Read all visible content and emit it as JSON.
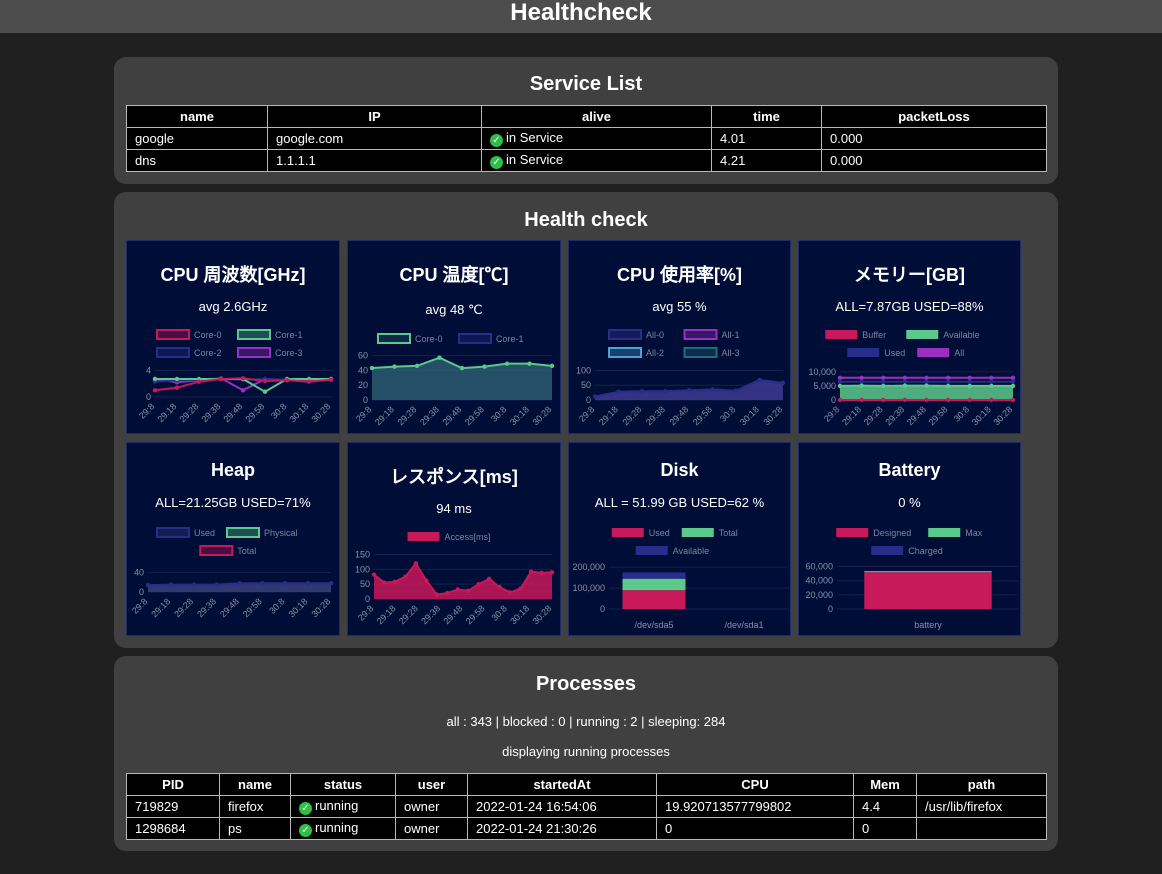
{
  "header": {
    "title": "Healthcheck"
  },
  "services": {
    "title": "Service List",
    "columns": [
      "name",
      "IP",
      "alive",
      "time",
      "packetLoss"
    ],
    "rows": [
      {
        "name": "google",
        "ip": "google.com",
        "alive": "in Service",
        "time": "4.01",
        "loss": "0.000"
      },
      {
        "name": "dns",
        "ip": "1.1.1.1",
        "alive": "in Service",
        "time": "4.21",
        "loss": "0.000"
      }
    ]
  },
  "health": {
    "title": "Health check"
  },
  "chart_data": [
    {
      "id": "cpu-freq",
      "type": "line",
      "title": "CPU 周波数[GHz]",
      "subtitle": "avg 2.6GHz",
      "categories": [
        "29:8",
        "29:18",
        "29:28",
        "29:38",
        "29:48",
        "29:58",
        "30:8",
        "30:18",
        "30:28"
      ],
      "yticks": [
        0,
        4
      ],
      "ylim": [
        0,
        4.2
      ],
      "legend": [
        "Core-0",
        "Core-1",
        "Core-2",
        "Core-3"
      ],
      "series": [
        {
          "name": "Core-0",
          "color": "#c8195a",
          "values": [
            1.0,
            1.4,
            2.3,
            2.7,
            2.8,
            2.4,
            2.5,
            2.3,
            2.6
          ]
        },
        {
          "name": "Core-1",
          "color": "#5cc98c",
          "values": [
            2.7,
            2.7,
            2.7,
            2.7,
            2.7,
            0.8,
            2.7,
            2.7,
            2.7
          ]
        },
        {
          "name": "Core-2",
          "color": "#262d8a",
          "values": [
            2.3,
            2.5,
            2.6,
            2.7,
            2.6,
            2.7,
            2.6,
            2.7,
            2.6
          ]
        },
        {
          "name": "Core-3",
          "color": "#9b2fc0",
          "values": [
            2.7,
            2.2,
            2.5,
            2.8,
            1.0,
            2.7,
            2.6,
            2.4,
            2.7
          ]
        }
      ]
    },
    {
      "id": "cpu-temp",
      "type": "area",
      "title": "CPU 温度[℃]",
      "subtitle": "avg 48 ℃",
      "categories": [
        "29:8",
        "29:18",
        "29:28",
        "29:38",
        "29:48",
        "29:58",
        "30:8",
        "30:18",
        "30:28"
      ],
      "yticks": [
        0,
        20,
        40,
        60
      ],
      "ylim": [
        0,
        62
      ],
      "legend": [
        "Core-0",
        "Core-1"
      ],
      "series": [
        {
          "name": "Core-0",
          "color": "#5cc98c",
          "fill": "#2b5c6e",
          "values": [
            43,
            45,
            46,
            57,
            43,
            45,
            49,
            49,
            46
          ]
        },
        {
          "name": "Core-1",
          "color": "#262d8a",
          "values": []
        }
      ]
    },
    {
      "id": "cpu-usage",
      "type": "area",
      "title": "CPU 使用率[%]",
      "subtitle": "avg 55 %",
      "categories": [
        "29:8",
        "29:18",
        "29:28",
        "29:38",
        "29:48",
        "29:58",
        "30:8",
        "30:18",
        "30:28"
      ],
      "yticks": [
        0,
        50,
        100
      ],
      "ylim": [
        0,
        105
      ],
      "legend": [
        "All-0",
        "All-1",
        "All-2",
        "All-3"
      ],
      "series": [
        {
          "name": "All-0",
          "color": "#262d8a",
          "fill": "#3c3a90",
          "values": [
            12,
            28,
            30,
            30,
            33,
            36,
            32,
            68,
            58
          ]
        },
        {
          "name": "All-1",
          "color": "#9b2fc0",
          "values": []
        },
        {
          "name": "All-2",
          "color": "#4aa3d8",
          "values": []
        },
        {
          "name": "All-3",
          "color": "#236a7a",
          "values": []
        }
      ]
    },
    {
      "id": "memory",
      "type": "area",
      "title": "メモリー[GB]",
      "subtitle": "ALL=7.87GB USED=88%",
      "categories": [
        "29:8",
        "29:18",
        "29:28",
        "29:38",
        "29:48",
        "29:58",
        "30:8",
        "30:18",
        "30:28"
      ],
      "yticks": [
        0,
        5000,
        10000
      ],
      "ytick_labels": [
        "0",
        "5,000",
        "10,000"
      ],
      "ylim": [
        0,
        11000
      ],
      "legend": [
        "Buffer",
        "Available",
        "Used",
        "All"
      ],
      "series": [
        {
          "name": "Buffer",
          "color": "#c8195a",
          "values": [
            0,
            0,
            0,
            0,
            0,
            0,
            0,
            0,
            0
          ]
        },
        {
          "name": "Available",
          "color": "#5cc98c",
          "fill": "#5cc98c",
          "values": [
            5000,
            5100,
            5000,
            5100,
            5100,
            5000,
            5000,
            5000,
            5000
          ]
        },
        {
          "name": "Used",
          "color": "#262d8a",
          "values": [
            6500,
            6500,
            6500,
            6500,
            6500,
            6500,
            6500,
            6500,
            6500
          ]
        },
        {
          "name": "All",
          "color": "#9b2fc0",
          "values": [
            7870,
            7870,
            7870,
            7870,
            7870,
            7870,
            7870,
            7870,
            7870
          ]
        }
      ]
    },
    {
      "id": "heap",
      "type": "area",
      "title": "Heap",
      "subtitle": "ALL=21.25GB USED=71%",
      "categories": [
        "29:8",
        "29:18",
        "29:28",
        "29:38",
        "29:48",
        "29:58",
        "30:8",
        "30:18",
        "30:28"
      ],
      "yticks": [
        0,
        40
      ],
      "ylim": [
        0,
        55
      ],
      "legend": [
        "Used",
        "Physical",
        "Total"
      ],
      "series": [
        {
          "name": "Used",
          "color": "#262d8a",
          "fill": "#3a3f7a",
          "values": [
            14,
            15,
            15,
            15,
            18,
            18,
            18,
            18,
            18
          ]
        },
        {
          "name": "Physical",
          "color": "#5cc98c",
          "values": []
        },
        {
          "name": "Total",
          "color": "#c8195a",
          "values": []
        }
      ]
    },
    {
      "id": "response",
      "type": "area",
      "title": "レスポンス[ms]",
      "subtitle": "94 ms",
      "categories": [
        "29:8",
        "29:18",
        "29:28",
        "29:38",
        "29:48",
        "29:58",
        "30:8",
        "30:18",
        "30:28"
      ],
      "yticks": [
        0,
        50,
        100,
        150
      ],
      "ylim": [
        0,
        155
      ],
      "legend": [
        "Access[ms]"
      ],
      "series": [
        {
          "name": "Access[ms]",
          "color": "#c8195a",
          "fill": "#c8195a",
          "values": [
            82,
            55,
            58,
            75,
            120,
            62,
            15,
            20,
            32,
            28,
            50,
            68,
            40,
            22,
            35,
            92,
            88,
            90
          ]
        }
      ]
    },
    {
      "id": "disk",
      "type": "bar",
      "title": "Disk",
      "subtitle": "ALL = 51.99 GB USED=62 %",
      "categories": [
        "/dev/sda5",
        "/dev/sda1"
      ],
      "yticks": [
        0,
        100000,
        200000
      ],
      "ytick_labels": [
        "0",
        "100,000",
        "200,000"
      ],
      "ylim": [
        0,
        220000
      ],
      "legend": [
        "Used",
        "Total",
        "Available"
      ],
      "series": [
        {
          "name": "Used",
          "color": "#c8195a",
          "values": [
            90000,
            0
          ]
        },
        {
          "name": "Total",
          "color": "#5cc98c",
          "values": [
            55000,
            0
          ]
        },
        {
          "name": "Available",
          "color": "#262d8a",
          "values": [
            30000,
            0
          ]
        }
      ]
    },
    {
      "id": "battery",
      "type": "bar",
      "title": "Battery",
      "subtitle": "0 %",
      "categories": [
        "battery"
      ],
      "yticks": [
        0,
        20000,
        40000,
        60000
      ],
      "ytick_labels": [
        "0",
        "20,000",
        "40,000",
        "60,000"
      ],
      "ylim": [
        0,
        65000
      ],
      "legend": [
        "Designed",
        "Max",
        "Charged"
      ],
      "series": [
        {
          "name": "Designed",
          "color": "#c8195a",
          "values": [
            52000
          ]
        },
        {
          "name": "Max",
          "color": "#5cc98c",
          "values": [
            1500
          ]
        },
        {
          "name": "Charged",
          "color": "#262d8a",
          "values": [
            0
          ]
        }
      ]
    }
  ],
  "processes": {
    "title": "Processes",
    "summary": "all : 343 | blocked : 0 | running : 2 | sleeping: 284",
    "note": "displaying running processes",
    "columns": [
      "PID",
      "name",
      "status",
      "user",
      "startedAt",
      "CPU",
      "Mem",
      "path"
    ],
    "rows": [
      {
        "pid": "719829",
        "name": "firefox",
        "status": "running",
        "user": "owner",
        "started": "2022-01-24 16:54:06",
        "cpu": "19.920713577799802",
        "mem": "4.4",
        "path": "/usr/lib/firefox"
      },
      {
        "pid": "1298684",
        "name": "ps",
        "status": "running",
        "user": "owner",
        "started": "2022-01-24 21:30:26",
        "cpu": "0",
        "mem": "0",
        "path": ""
      }
    ]
  },
  "icons": {
    "status_ok": "check-circle-icon",
    "ok_color": "#2fbf47"
  }
}
